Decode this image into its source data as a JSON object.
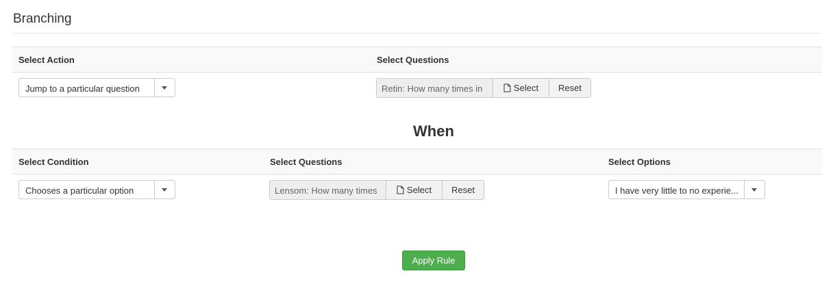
{
  "page": {
    "title": "Branching"
  },
  "action_section": {
    "headers": {
      "action": "Select Action",
      "questions": "Select Questions"
    },
    "action_select": {
      "value": "Jump to a particular question"
    },
    "question_group": {
      "value": "Retin: How many times in",
      "select_label": "Select",
      "reset_label": "Reset"
    }
  },
  "when_heading": "When",
  "condition_section": {
    "headers": {
      "condition": "Select Condition",
      "questions": "Select Questions",
      "options": "Select Options"
    },
    "condition_select": {
      "value": "Chooses a particular option"
    },
    "question_group": {
      "value": "Lensom: How many times",
      "select_label": "Select",
      "reset_label": "Reset"
    },
    "options_select": {
      "value": "I have very little to no experie..."
    }
  },
  "apply_button": {
    "label": "Apply Rule",
    "color": "#4cae4c"
  },
  "icons": {
    "file": "file-icon",
    "caret": "caret-down-icon"
  }
}
